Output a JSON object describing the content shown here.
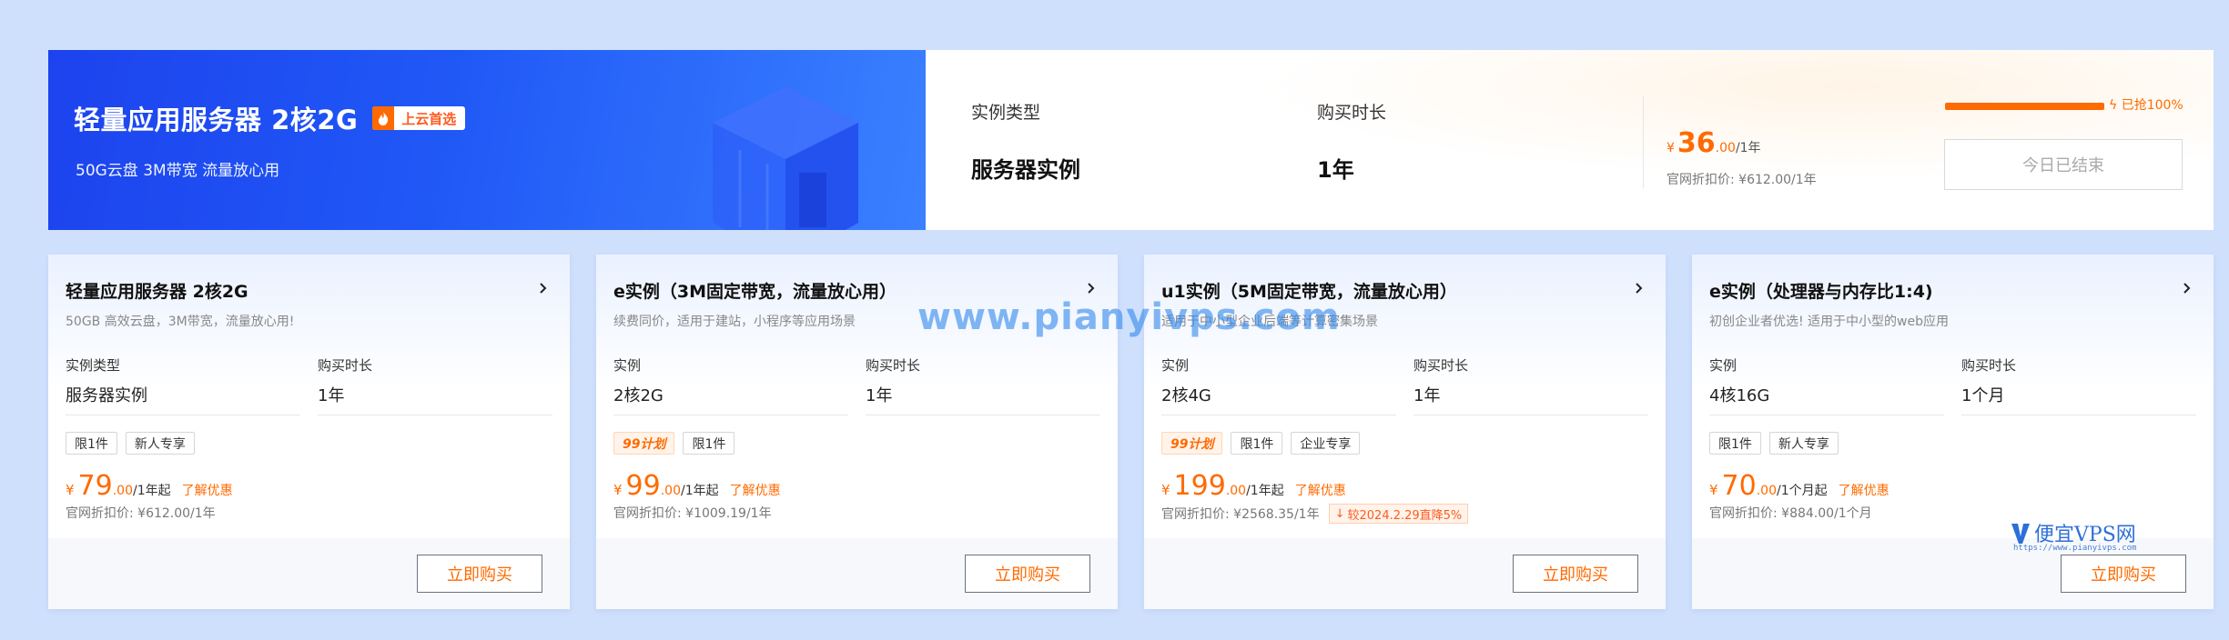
{
  "hero": {
    "title": "轻量应用服务器 2核2G",
    "badge": "上云首选",
    "subtitle": "50G云盘 3M带宽 流量放心用",
    "spec_type_label": "实例类型",
    "spec_type_value": "服务器实例",
    "spec_duration_label": "购买时长",
    "spec_duration_value": "1年",
    "price_currency": "¥",
    "price_int": "36",
    "price_dec": ".00",
    "price_unit": "/1年",
    "official_price": "官网折扣价: ¥612.00/1年",
    "progress_percent": 100,
    "progress_text": "已抢100%",
    "ended_label": "今日已结束",
    "accent_color": "#ff6a00",
    "icons": [
      "fire-icon",
      "lightning-icon"
    ]
  },
  "cards": [
    {
      "title": "轻量应用服务器 2核2G",
      "subtitle": "50GB 高效云盘，3M带宽，流量放心用!",
      "spec1_label": "实例类型",
      "spec1_value": "服务器实例",
      "spec2_label": "购买时长",
      "spec2_value": "1年",
      "tags": [
        "限1件",
        "新人专享"
      ],
      "price_currency": "¥",
      "price_int": "79",
      "price_dec": ".00",
      "price_unit": "/1年起",
      "promo": "了解优惠",
      "official_price": "官网折扣价: ¥612.00/1年",
      "buy_label": "立即购买"
    },
    {
      "title": "e实例（3M固定带宽，流量放心用）",
      "subtitle": "续费同价，适用于建站，小程序等应用场景",
      "spec1_label": "实例",
      "spec1_value": "2核2G",
      "spec2_label": "购买时长",
      "spec2_value": "1年",
      "plan_tag": "99计划",
      "tags": [
        "限1件"
      ],
      "price_currency": "¥",
      "price_int": "99",
      "price_dec": ".00",
      "price_unit": "/1年起",
      "promo": "了解优惠",
      "official_price": "官网折扣价: ¥1009.19/1年",
      "buy_label": "立即购买"
    },
    {
      "title": "u1实例（5M固定带宽，流量放心用）",
      "subtitle": "适用于中小型企业后端等计算密集场景",
      "spec1_label": "实例",
      "spec1_value": "2核4G",
      "spec2_label": "购买时长",
      "spec2_value": "1年",
      "plan_tag": "99计划",
      "tags": [
        "限1件",
        "企业专享"
      ],
      "price_currency": "¥",
      "price_int": "199",
      "price_dec": ".00",
      "price_unit": "/1年起",
      "promo": "了解优惠",
      "official_price": "官网折扣价: ¥2568.35/1年",
      "drop_badge": "较2024.2.29直降5%",
      "buy_label": "立即购买"
    },
    {
      "title": "e实例（处理器与内存比1:4)",
      "subtitle": "初创企业者优选! 适用于中小型的web应用",
      "spec1_label": "实例",
      "spec1_value": "4核16G",
      "spec2_label": "购买时长",
      "spec2_value": "1个月",
      "tags": [
        "限1件",
        "新人专享"
      ],
      "price_currency": "¥",
      "price_int": "70",
      "price_dec": ".00",
      "price_unit": "/1个月起",
      "promo": "了解优惠",
      "official_price": "官网折扣价: ¥884.00/1个月",
      "buy_label": "立即购买"
    }
  ],
  "watermark": {
    "text": "www.pianyivps.com",
    "logo_name": "便宜VPS网",
    "logo_url": "https://www.pianyivps.com"
  }
}
